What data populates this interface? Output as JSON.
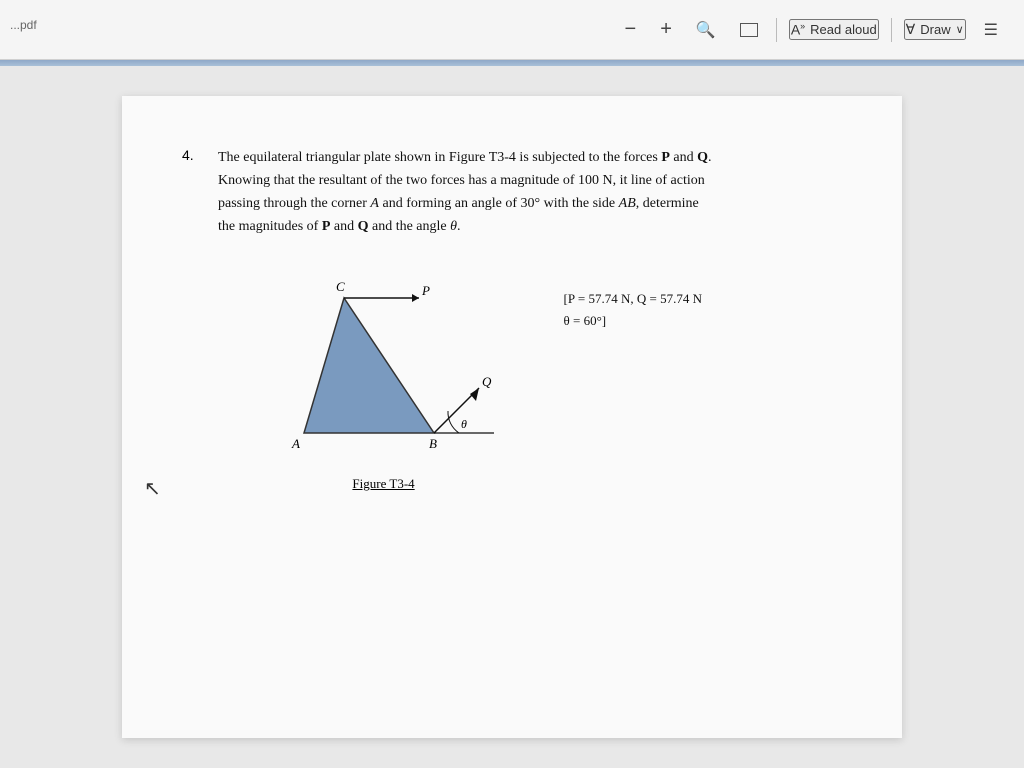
{
  "toolbar": {
    "title": "...pdf",
    "minus_label": "−",
    "plus_label": "+",
    "zoom_label": "",
    "fit_label": "",
    "read_aloud_label": "Read aloud",
    "draw_label": "Draw",
    "separator": "|"
  },
  "problem": {
    "number": "4.",
    "text_line1": "The equilateral triangular plate shown in Figure T3-4 is subjected to the forces ",
    "bold_P": "P",
    "text_and": " and ",
    "bold_Q": "Q",
    "text_line1_end": ".",
    "text_line2": "Knowing that the resultant of the two forces has a magnitude of 100 N, it line of action",
    "text_line3_start": "passing through the corner ",
    "italic_A": "A",
    "text_line3_mid": " and forming an angle of 30° with the side ",
    "italic_AB": "AB",
    "text_line3_end": ", determine",
    "text_line4_start": "the magnitudes of ",
    "bold_P2": "P",
    "text_line4_and": " and ",
    "bold_Q2": "Q",
    "text_line4_end": " and the angle ",
    "italic_theta": "θ",
    "text_line4_final": ".",
    "answer_line1": "[P = 57.74 N, Q = 57.74 N",
    "answer_line2": "θ = 60°]",
    "figure_caption": "Figure T3-4",
    "labels": {
      "A": "A",
      "B": "B",
      "C": "C",
      "P": "P",
      "Q": "Q",
      "theta": "θ"
    }
  }
}
